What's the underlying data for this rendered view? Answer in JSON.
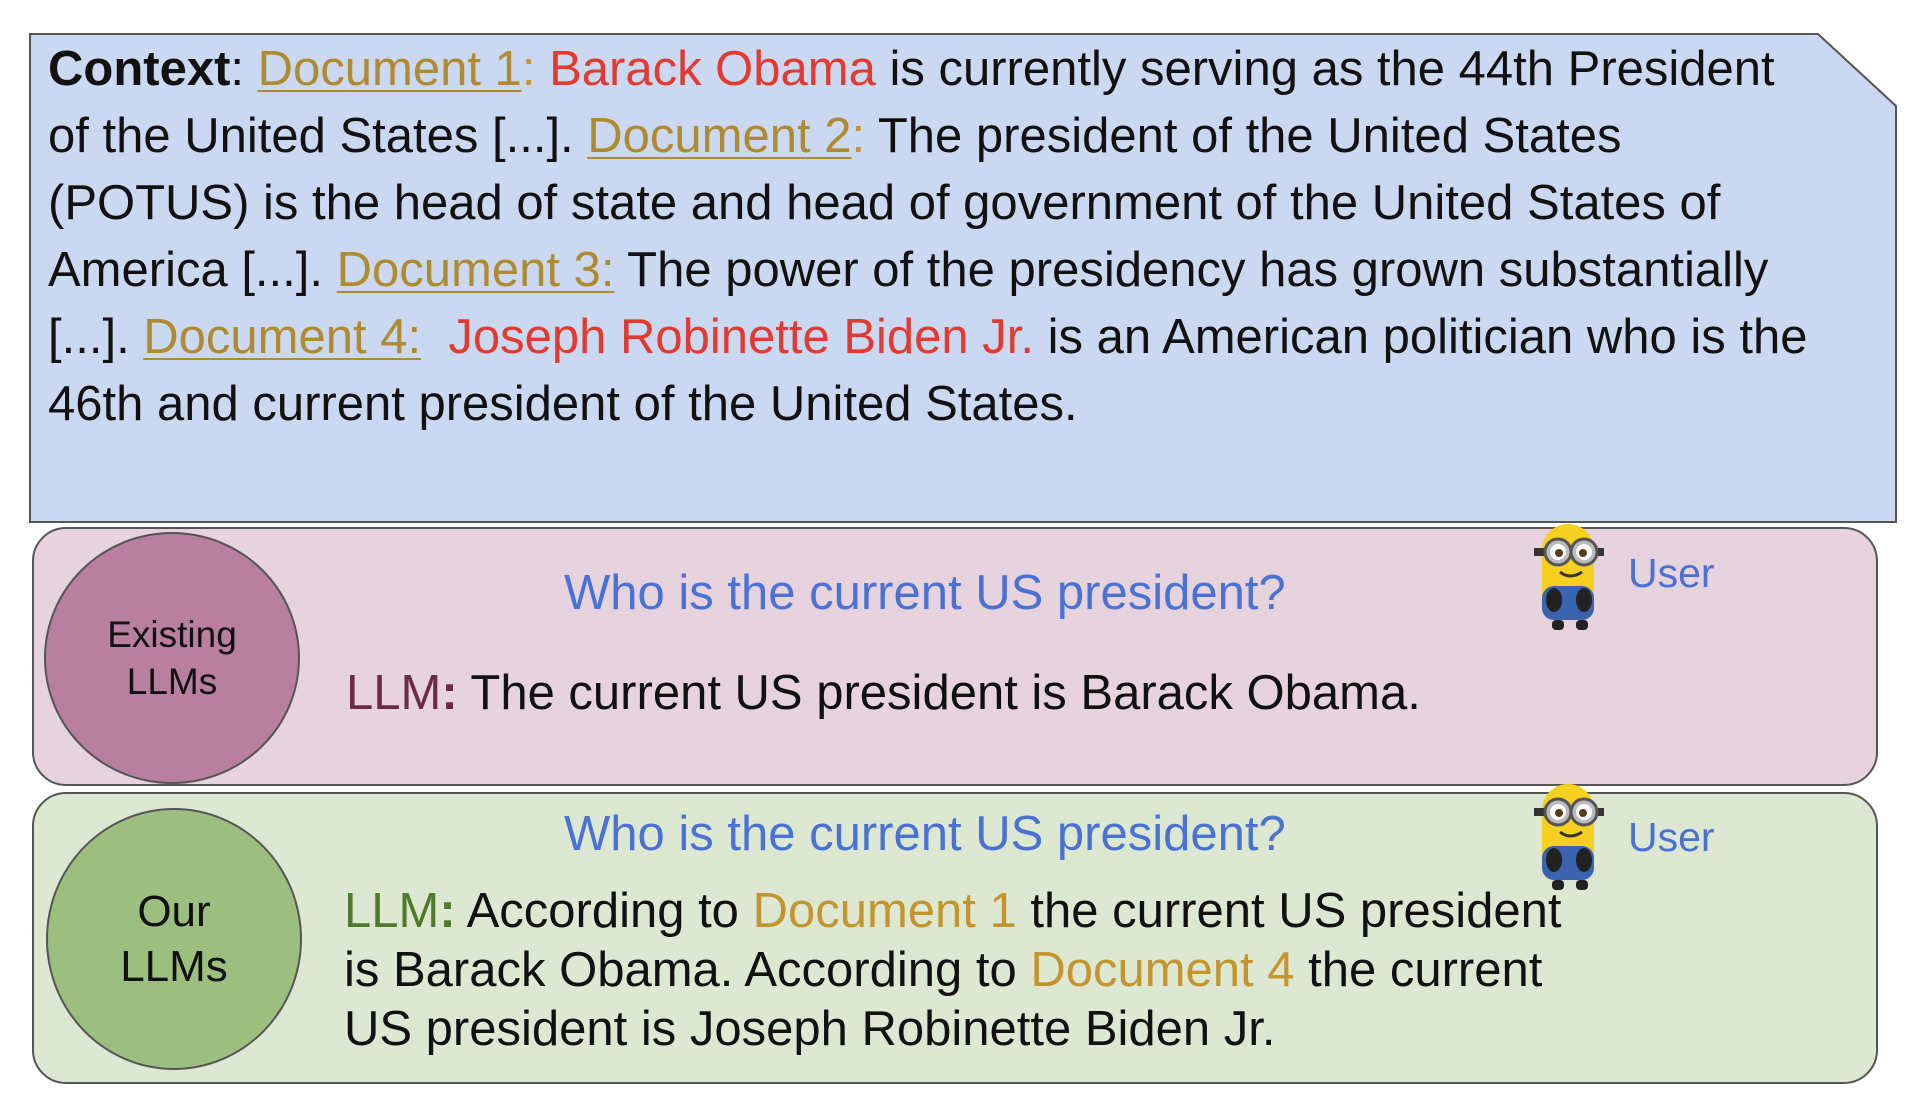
{
  "context": {
    "label": "Context",
    "colon": ": ",
    "doc1": "Document 1",
    "doc1_colon": ": ",
    "entity1": "Barack Obama",
    "text1": " is currently serving as the 44th President of the United States [...]. ",
    "doc2": "Document 2",
    "doc2_colon": ":",
    "text2": " The president of the United States (POTUS) is the head of state and head of government of the United States of America [...]. ",
    "doc3": "Document 3:",
    "text3": " The power of the presidency has grown substantially [...]. ",
    "doc4": "Document 4:",
    "spacer": "  ",
    "entity2": "Joseph Robinette Biden Jr.",
    "text4": " is an American politician who is the 46th and current president of the United States."
  },
  "existing": {
    "circle_line1": "Existing",
    "circle_line2": "LLMs",
    "question": "Who is the current US president?",
    "user_label": "User",
    "llm_prefix": "LLM",
    "llm_colon": ":",
    "answer": " The current US president is Barack Obama."
  },
  "ours": {
    "circle_line1": "Our",
    "circle_line2": "LLMs",
    "question": "Who is the current US president?",
    "user_label": "User",
    "llm_prefix": "LLM",
    "llm_colon": ":",
    "answer_part1": " According to ",
    "doc_a": "Document 1",
    "answer_part2": " the current US president is Barack Obama. According to ",
    "doc_b": "Document 4",
    "answer_part3": " the current US president is Joseph Robinette Biden Jr."
  },
  "colors": {
    "context_bg": "#cad8f2",
    "existing_bg": "#e6d3dd",
    "existing_circle": "#b87f9e",
    "ours_bg": "#dde8d3",
    "ours_circle": "#9cbf7f",
    "question": "#4a72d4",
    "doc_ref": "#b08a2e",
    "entity": "#e23a2f"
  },
  "icons": [
    "minion-icon",
    "minion-icon"
  ]
}
